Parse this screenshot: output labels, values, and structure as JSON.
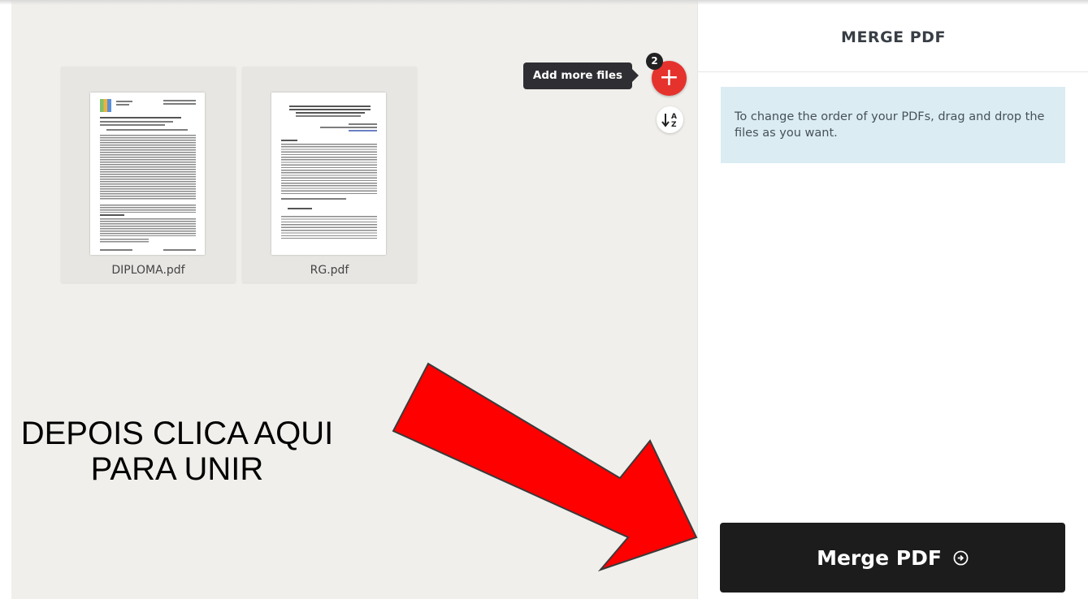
{
  "sidebar": {
    "title": "MERGE PDF",
    "info_text": "To change the order of your PDFs, drag and drop the files as you want.",
    "merge_button_label": "Merge PDF",
    "merge_button_icon": "arrow-circle-right-icon"
  },
  "workspace": {
    "add_files_tooltip": "Add more files",
    "file_count": "2",
    "add_icon": "plus-icon",
    "sort_icon": "sort-alpha-icon",
    "files": [
      {
        "name": "DIPLOMA.pdf"
      },
      {
        "name": "RG.pdf"
      }
    ]
  },
  "annotation": {
    "text_line1": "DEPOIS CLICA AQUI",
    "text_line2": "PARA UNIR",
    "arrow_color": "#ff0000"
  },
  "colors": {
    "accent": "#e5322d",
    "workspace_bg": "#f1efeb",
    "info_bg": "#dbecf3",
    "button_bg": "#1c1c1c"
  }
}
